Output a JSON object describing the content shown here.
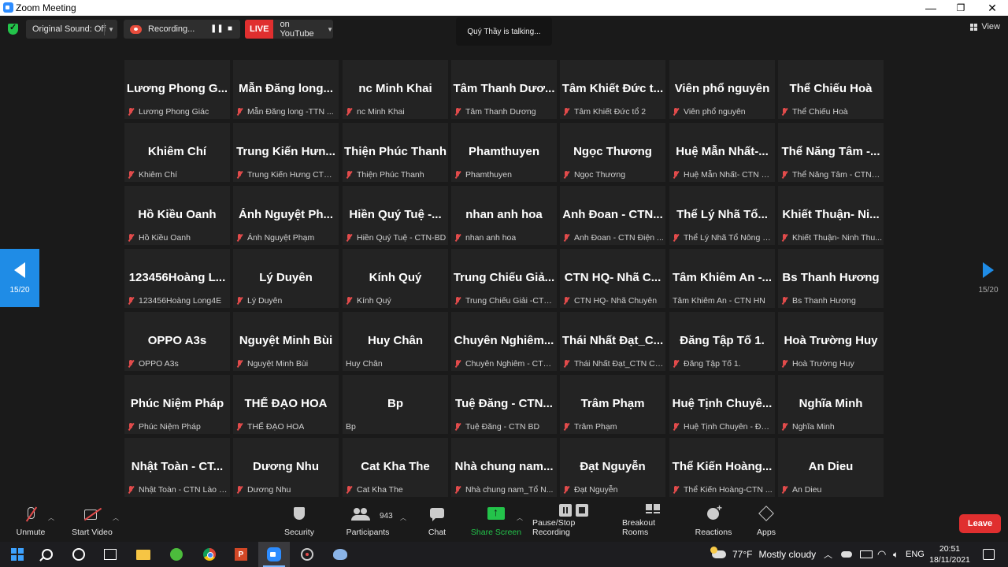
{
  "window": {
    "title": "Zoom Meeting",
    "minimize": "—",
    "maximize": "❐",
    "close": "✕"
  },
  "toolbar": {
    "original_sound": "Original Sound: Off",
    "recording": "Recording...",
    "live_badge": "LIVE",
    "live_target": "on YouTube",
    "view": "View"
  },
  "speaking": "Quý Thầy is talking...",
  "pager": {
    "left": "15/20",
    "right": "15/20"
  },
  "tiles": [
    {
      "big": "Lương Phong G...",
      "small": "Lương Phong Giác",
      "muted": true
    },
    {
      "big": "Mẫn Đăng long...",
      "small": "Mẫn Đăng long -TTN ...",
      "muted": true
    },
    {
      "big": "nc Minh Khai",
      "small": "nc Minh Khai",
      "muted": true
    },
    {
      "big": "Tâm Thanh Dươ...",
      "small": "Tâm Thanh Dương",
      "muted": true
    },
    {
      "big": "Tâm Khiết Đức t...",
      "small": "Tâm Khiết Đức tổ 2",
      "muted": true
    },
    {
      "big": "Viên phổ nguyên",
      "small": "Viên phổ nguyên",
      "muted": true
    },
    {
      "big": "Thể Chiếu Hoà",
      "small": "Thể Chiếu Hoà",
      "muted": true
    },
    {
      "big": "Khiêm Chí",
      "small": "Khiêm Chí",
      "muted": true
    },
    {
      "big": "Trung Kiến Hưn...",
      "small": "Trung Kiến Hưng CTN ...",
      "muted": true
    },
    {
      "big": "Thiện Phúc Thanh",
      "small": "Thiện Phúc Thanh",
      "muted": true
    },
    {
      "big": "Phamthuyen",
      "small": "Phamthuyen",
      "muted": true
    },
    {
      "big": "Ngọc Thương",
      "small": "Ngọc Thương",
      "muted": true
    },
    {
      "big": "Huệ Mẫn Nhất-...",
      "small": "Huệ Mẫn Nhất- CTN N...",
      "muted": true
    },
    {
      "big": "Thể Năng Tâm -...",
      "small": "Thể Năng Tâm - CTN H...",
      "muted": true
    },
    {
      "big": "Hồ Kiều Oanh",
      "small": "Hồ Kiều Oanh",
      "muted": true
    },
    {
      "big": "Ánh Nguyệt Ph...",
      "small": "Ánh Nguyệt Phạm",
      "muted": true
    },
    {
      "big": "Hiền Quý Tuệ -...",
      "small": "Hiền Quý Tuệ - CTN-BD",
      "muted": true
    },
    {
      "big": "nhan anh hoa",
      "small": "nhan anh hoa",
      "muted": true
    },
    {
      "big": "Anh Đoan - CTN...",
      "small": "Anh Đoan - CTN Điện ...",
      "muted": true
    },
    {
      "big": "Thể Lý Nhã Tổ...",
      "small": "Thể Lý Nhã Tổ Nông N...",
      "muted": true
    },
    {
      "big": "Khiết Thuận- Ni...",
      "small": "Khiết Thuận- Ninh Thu...",
      "muted": true
    },
    {
      "big": "123456Hoàng L...",
      "small": "123456Hoàng Long4E",
      "muted": true
    },
    {
      "big": "Lý Duyên",
      "small": "Lý Duyên",
      "muted": true
    },
    {
      "big": "Kính Quý",
      "small": "Kính Quý",
      "muted": true
    },
    {
      "big": "Trung Chiếu Giả...",
      "small": "Trung Chiếu Giải -CTN ...",
      "muted": true
    },
    {
      "big": "CTN  HQ- Nhã C...",
      "small": "CTN  HQ- Nhã Chuyên",
      "muted": true
    },
    {
      "big": "Tâm Khiêm An -...",
      "small": "Tâm Khiêm An - CTN HN",
      "muted": false
    },
    {
      "big": "Bs Thanh Hương",
      "small": "Bs Thanh Hương",
      "muted": true
    },
    {
      "big": "OPPO A3s",
      "small": "OPPO A3s",
      "muted": true
    },
    {
      "big": "Nguyệt Minh Bùi",
      "small": "Nguyệt Minh Bùi",
      "muted": true
    },
    {
      "big": "Huy Chân",
      "small": "Huy Chân",
      "muted": false
    },
    {
      "big": "Chuyên  Nghiêm...",
      "small": "Chuyên Nghiêm - CTN...",
      "muted": true
    },
    {
      "big": "Thái  Nhất  Đạt_C...",
      "small": "Thái Nhất Đạt_CTN Cầ...",
      "muted": true
    },
    {
      "big": "Đăng Tập Tố 1.",
      "small": "Đăng Tập Tố 1.",
      "muted": true
    },
    {
      "big": "Hoà Trường Huy",
      "small": "Hoà Trường Huy",
      "muted": true
    },
    {
      "big": "Phúc Niệm Pháp",
      "small": "Phúc Niệm Pháp",
      "muted": true
    },
    {
      "big": "THỂ ĐẠO HOA",
      "small": "THỂ ĐẠO HOA",
      "muted": true
    },
    {
      "big": "Bp",
      "small": "Bp",
      "muted": false
    },
    {
      "big": "Tuệ Đăng - CTN...",
      "small": "Tuệ Đăng - CTN BD",
      "muted": true
    },
    {
      "big": "Trâm Phạm",
      "small": "Trâm Phạm",
      "muted": true
    },
    {
      "big": "Huệ Tịnh Chuyê...",
      "small": "Huệ Tịnh Chuyên - ĐT ...",
      "muted": true
    },
    {
      "big": "Nghĩa Minh",
      "small": "Nghĩa Minh",
      "muted": true
    },
    {
      "big": "Nhật Toàn - CT...",
      "small": "Nhật Toàn - CTN Lào C...",
      "muted": true
    },
    {
      "big": "Dương Nhu",
      "small": "Dương Nhu",
      "muted": true
    },
    {
      "big": "Cat Kha The",
      "small": "Cat Kha The",
      "muted": true
    },
    {
      "big": "Nhà chung nam...",
      "small": "Nhà chung nam_Tổ N...",
      "muted": true
    },
    {
      "big": "Đạt Nguyễn",
      "small": "Đạt Nguyễn",
      "muted": true
    },
    {
      "big": "Thể Kiến Hoàng...",
      "small": "Thể Kiến Hoàng-CTN ...",
      "muted": true
    },
    {
      "big": "An Dieu",
      "small": "An Dieu",
      "muted": true
    }
  ],
  "controls": {
    "unmute": "Unmute",
    "start_video": "Start Video",
    "security": "Security",
    "participants": "Participants",
    "participant_count": "943",
    "chat": "Chat",
    "share_screen": "Share Screen",
    "pause_stop_recording": "Pause/Stop Recording",
    "breakout_rooms": "Breakout Rooms",
    "reactions": "Reactions",
    "apps": "Apps",
    "leave": "Leave"
  },
  "colors": {
    "share_green": "#23c34a",
    "leave_red": "#e02f2f",
    "accent_blue": "#1f8ce6",
    "mute_red": "#e24b4b"
  },
  "taskbar": {
    "weather_temp": "77°F",
    "weather_desc": "Mostly cloudy",
    "lang": "ENG",
    "time": "20:51",
    "date": "18/11/2021",
    "ppt_letter": "P"
  }
}
